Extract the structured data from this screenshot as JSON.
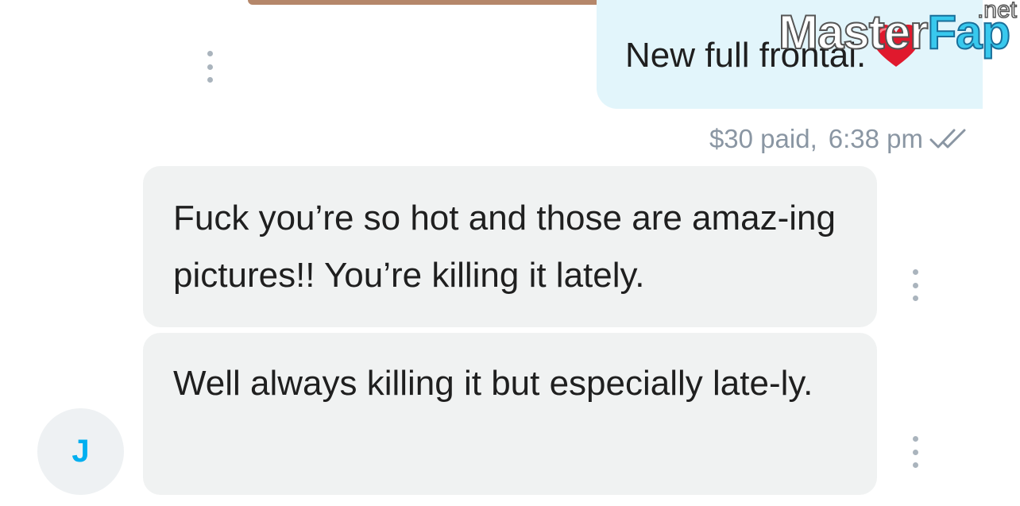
{
  "sent_message": {
    "text": "New full frontal.",
    "emoji": "heart-emoji",
    "price": "$30 paid",
    "separator": ",",
    "time": "6:38 pm",
    "status_icon": "double-check-icon"
  },
  "received_messages": [
    {
      "text": "Fuck you’re so hot and those are amaz-ing pictures!! You’re killing it lately."
    },
    {
      "text": "Well always killing it but especially late-ly."
    }
  ],
  "avatar": {
    "initial": "J"
  },
  "watermark": {
    "main": "Master",
    "accent": "Fap",
    "suffix": ".net"
  },
  "colors": {
    "sent_bubble": "#e2f5fb",
    "received_bubble": "#f0f2f2",
    "meta_text": "#8a96a3",
    "avatar_initial": "#00aff0",
    "heart": "#e0192d"
  }
}
